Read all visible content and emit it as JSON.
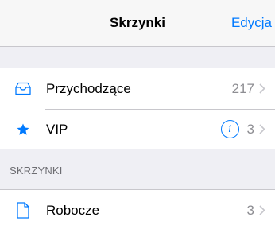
{
  "navbar": {
    "title": "Skrzynki",
    "edit_label": "Edycja"
  },
  "mailboxes": [
    {
      "label": "Przychodzące",
      "count": "217",
      "icon": "inbox-tray-icon"
    },
    {
      "label": "VIP",
      "count": "3",
      "icon": "star-icon",
      "has_info": true
    }
  ],
  "section": {
    "header": "SKRZYNKI",
    "items": [
      {
        "label": "Robocze",
        "count": "3",
        "icon": "document-icon"
      }
    ]
  },
  "colors": {
    "accent": "#007aff",
    "secondary_text": "#8e8e93",
    "background": "#efeff4",
    "separator": "#c8c7cc"
  }
}
